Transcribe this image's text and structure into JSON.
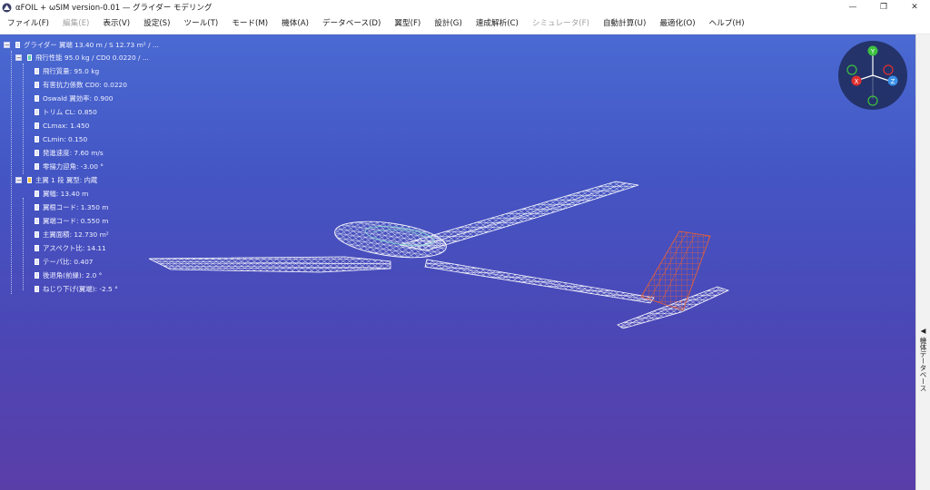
{
  "window": {
    "title": "αFOIL + ωSIM version-0.01 — グライダー モデリング",
    "minimize": "—",
    "restore": "❐",
    "close": "✕"
  },
  "menu": [
    {
      "label": "ファイル(F)",
      "enabled": true
    },
    {
      "label": "編集(E)",
      "enabled": false
    },
    {
      "label": "表示(V)",
      "enabled": true
    },
    {
      "label": "設定(S)",
      "enabled": true
    },
    {
      "label": "ツール(T)",
      "enabled": true
    },
    {
      "label": "モード(M)",
      "enabled": true
    },
    {
      "label": "機体(A)",
      "enabled": true
    },
    {
      "label": "データベース(D)",
      "enabled": true
    },
    {
      "label": "翼型(F)",
      "enabled": true
    },
    {
      "label": "設計(G)",
      "enabled": true
    },
    {
      "label": "連成解析(C)",
      "enabled": true
    },
    {
      "label": "シミュレータ(F)",
      "enabled": false
    },
    {
      "label": "自動計算(U)",
      "enabled": true
    },
    {
      "label": "最適化(O)",
      "enabled": true
    },
    {
      "label": "ヘルプ(H)",
      "enabled": true
    }
  ],
  "tree": {
    "root": "グライダー  翼端 13.40 m / S 12.73 m² / ...",
    "performance": {
      "label": "飛行性能  95.0 kg / CD0 0.0220 / ...",
      "items": [
        "飛行質量: 95.0 kg",
        "有害抗力係数 CD0: 0.0220",
        "Oswald 翼効率: 0.900",
        "トリム CL: 0.850",
        "CLmax: 1.450",
        "CLmin: 0.150",
        "発進速度: 7.60 m/s",
        "零揚力迎角: -3.00 °"
      ]
    },
    "main_wing": {
      "label": "主翼  1 段  翼型: 内蔵",
      "items": [
        "翼幅: 13.40 m",
        "翼根コード: 1.350 m",
        "翼端コード: 0.550 m",
        "主翼面積: 12.730 m²",
        "アスペクト比: 14.11",
        "テーパ比: 0.407",
        "後退角(前縁): 2.0 °",
        "ねじり下げ(翼端): -2.5 °"
      ]
    }
  },
  "gizmo": {
    "y": "Y",
    "x": "X",
    "z": "Z"
  },
  "side_panel": {
    "label": "◀ 機体データベース"
  },
  "colors": {
    "viewport_top": "#4a6ad2",
    "viewport_bottom": "#5a3ea8",
    "wireframe": "#ffffff",
    "rudder": "#e0603a",
    "canopy": "#7fd0d0",
    "gizmo_x": "#e03030",
    "gizmo_y": "#3cc040",
    "gizmo_z": "#3a90e8"
  }
}
